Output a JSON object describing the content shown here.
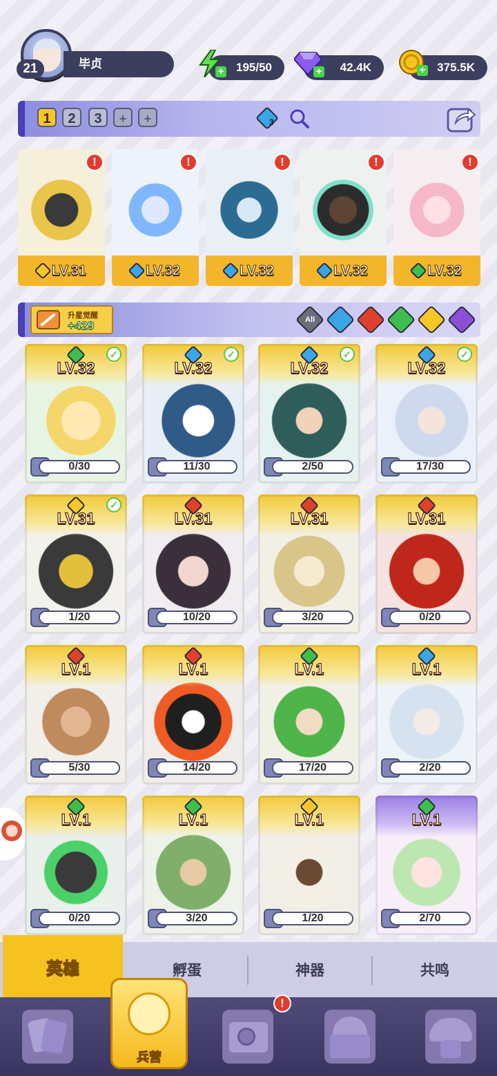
{
  "player": {
    "level": "21",
    "name": "毕贞"
  },
  "resources": {
    "energy": "195/50",
    "gems": "42.4K",
    "coins": "375.5K"
  },
  "team_slots": [
    "1",
    "2",
    "3",
    "+",
    "+"
  ],
  "team_badge": "3",
  "team_heroes": [
    {
      "level": "LV.31",
      "element": "light",
      "color": "#f7c728"
    },
    {
      "level": "LV.32",
      "element": "water",
      "color": "#3aa6e6"
    },
    {
      "level": "LV.32",
      "element": "water",
      "color": "#3aa6e6"
    },
    {
      "level": "LV.32",
      "element": "water",
      "color": "#3aa6e6"
    },
    {
      "level": "LV.32",
      "element": "nature",
      "color": "#3fbe4d"
    }
  ],
  "awaken": {
    "label": "升星觉醒",
    "value": "+429"
  },
  "filters": {
    "all": "All",
    "elements": [
      {
        "name": "water",
        "color": "#3aa6e6"
      },
      {
        "name": "fire",
        "color": "#e0412c"
      },
      {
        "name": "nature",
        "color": "#3fbe4d"
      },
      {
        "name": "light",
        "color": "#f7c728"
      },
      {
        "name": "dark",
        "color": "#8c4fd6"
      }
    ]
  },
  "heroes": [
    {
      "level": "LV.32",
      "progress": "0/30",
      "element": "#3fbe4d",
      "checked": true
    },
    {
      "level": "LV.32",
      "progress": "11/30",
      "element": "#3aa6e6",
      "checked": true
    },
    {
      "level": "LV.32",
      "progress": "2/50",
      "element": "#3aa6e6",
      "checked": true
    },
    {
      "level": "LV.32",
      "progress": "17/30",
      "element": "#3aa6e6",
      "checked": true
    },
    {
      "level": "LV.31",
      "progress": "1/20",
      "element": "#f7c728",
      "checked": true
    },
    {
      "level": "LV.31",
      "progress": "10/20",
      "element": "#e0412c",
      "checked": false
    },
    {
      "level": "LV.31",
      "progress": "3/20",
      "element": "#e0412c",
      "checked": false
    },
    {
      "level": "LV.31",
      "progress": "0/20",
      "element": "#e0412c",
      "checked": false
    },
    {
      "level": "LV.1",
      "progress": "5/30",
      "element": "#e0412c",
      "checked": false
    },
    {
      "level": "LV.1",
      "progress": "14/20",
      "element": "#e0412c",
      "checked": false
    },
    {
      "level": "LV.1",
      "progress": "17/20",
      "element": "#3fbe4d",
      "checked": false
    },
    {
      "level": "LV.1",
      "progress": "2/20",
      "element": "#3aa6e6",
      "checked": false
    },
    {
      "level": "LV.1",
      "progress": "0/20",
      "element": "#3fbe4d",
      "checked": false
    },
    {
      "level": "LV.1",
      "progress": "3/20",
      "element": "#3fbe4d",
      "checked": false
    },
    {
      "level": "LV.1",
      "progress": "1/20",
      "element": "#f7c728",
      "checked": false
    },
    {
      "level": "LV.1",
      "progress": "2/70",
      "element": "#3fbe4d",
      "checked": false
    }
  ],
  "tabs": [
    "英雄",
    "孵蛋",
    "神器",
    "共鸣"
  ],
  "nav": {
    "barracks": "兵营",
    "alert": "!"
  },
  "colors": {
    "accent": "#f5c21f",
    "panel": "#3b3e5d"
  }
}
